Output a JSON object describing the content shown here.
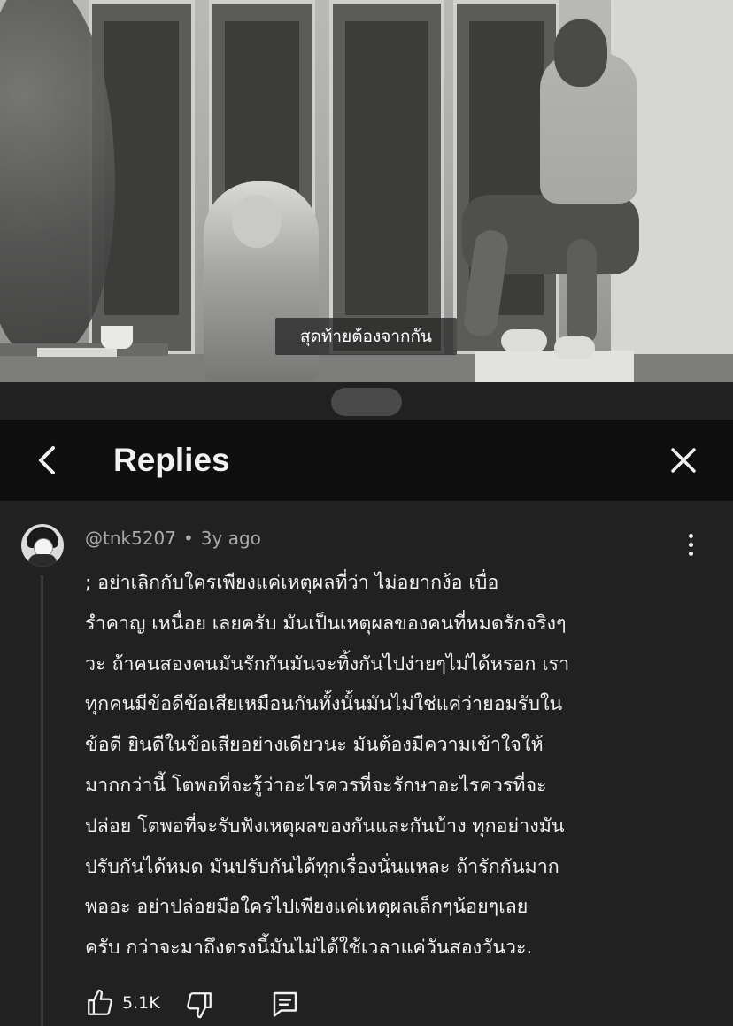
{
  "video": {
    "caption": "สุดท้ายต้องจากกัน"
  },
  "panel": {
    "title": "Replies"
  },
  "comment": {
    "author": "@tnk5207",
    "separator": "•",
    "time": "3y ago",
    "text": "; อย่าเลิกกับใครเพียงแค่เหตุผลที่ว่า ไม่อยากง้อ เบื่อ\nรำคาญ เหนื่อย เลยครับ มันเป็นเหตุผลของคนที่หมดรักจริงๆ\nวะ ถ้าคนสองคนมันรักกันมันจะทิ้งกันไปง่ายๆไม่ได้หรอก เรา\nทุกคนมีข้อดีข้อเสียเหมือนกันทั้งนั้นมันไม่ใช่แค่ว่ายอมรับใน\nข้อดี ยินดีในข้อเสียอย่างเดียวนะ มันต้องมีความเข้าใจให้\nมากกว่านี้ โตพอที่จะรู้ว่าอะไรควรที่จะรักษาอะไรควรที่จะ\nปล่อย โตพอที่จะรับฟังเหตุผลของกันและกันบ้าง ทุกอย่างมัน\nปรับกันได้หมด มันปรับกันได้ทุกเรื่องนั่นแหละ ถ้ารักกันมาก\nพออะ อย่าปล่อยมือใครไปเพียงแค่เหตุผลเล็กๆน้อยๆเลย\nครับ กว่าจะมาถึงตรงนี้มันไม่ได้ใช้เวลาแค่วันสองวันวะ.",
    "like_count": "5.1K"
  },
  "icons": {
    "back": "chevron-left-icon",
    "close": "close-icon",
    "more": "more-vertical-icon",
    "like": "thumbs-up-icon",
    "dislike": "thumbs-down-icon",
    "reply": "comment-reply-icon"
  },
  "colors": {
    "panel_bg": "#212121",
    "header_bg": "#0f0f0f",
    "text_primary": "#f1f1f1",
    "text_secondary": "#aaaaaa"
  }
}
